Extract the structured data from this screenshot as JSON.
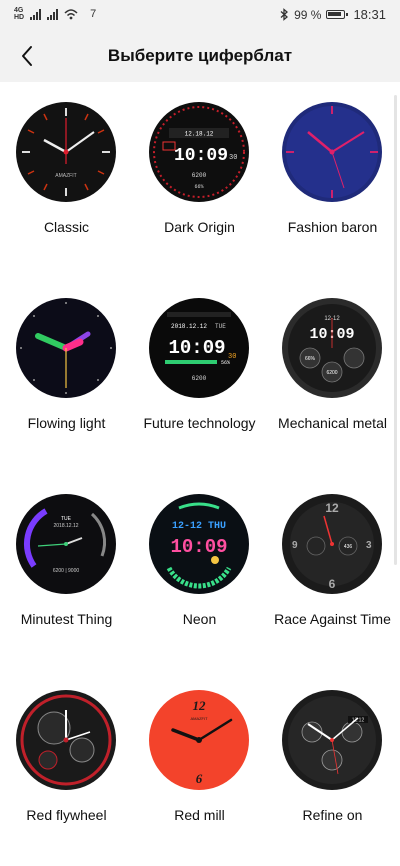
{
  "status": {
    "network": "4G",
    "network_sub": "HD",
    "notification_count": "7",
    "battery_pct": "99 %",
    "time": "18:31"
  },
  "header": {
    "title": "Выберите циферблат",
    "back_icon": "chevron-left-icon"
  },
  "faces": [
    {
      "label": "Classic",
      "brand": "AMAZFIT"
    },
    {
      "label": "Dark Origin",
      "time": "10:09",
      "date": "12.18.12",
      "seconds": "30",
      "steps": "6200",
      "battery": "66%"
    },
    {
      "label": "Fashion baron"
    },
    {
      "label": "Flowing light"
    },
    {
      "label": "Future technology",
      "time": "10:09",
      "seconds": "30",
      "date": "2018.12.12",
      "weekday": "TUE",
      "percent": "56%",
      "steps": "6200"
    },
    {
      "label": "Mechanical metal",
      "time": "10:09",
      "date": "12-12",
      "heart": "6200",
      "percent": "66%"
    },
    {
      "label": "Minutest Thing",
      "weekday": "TUE",
      "date": "2018.12.12",
      "steps": "6200 | 9000"
    },
    {
      "label": "Neon",
      "date": "12-12 THU",
      "time": "10:09"
    },
    {
      "label": "Race Against Time",
      "numeral_top": "12",
      "numeral_bottom": "6",
      "left": "9",
      "right": "3",
      "value": "436"
    },
    {
      "label": "Red flywheel"
    },
    {
      "label": "Red mill",
      "brand": "AMAZFIT",
      "numeral_top": "12",
      "numeral_bottom": "6"
    },
    {
      "label": "Refine on",
      "date": "12.12"
    }
  ]
}
